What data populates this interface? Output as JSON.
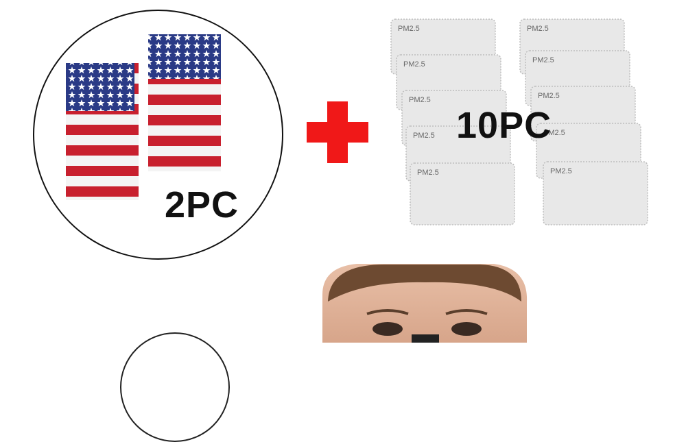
{
  "set": {
    "masks_label": "2PC",
    "filters_label": "10PC",
    "filter_tag": "PM2.5"
  },
  "colors": {
    "plus": "#f01818",
    "flag_red": "#c8202e",
    "flag_blue": "#2a3a86",
    "filter_gray": "#e8e8e8"
  },
  "icons": {
    "plus": "plus-icon",
    "flag": "us-flag-mask"
  }
}
